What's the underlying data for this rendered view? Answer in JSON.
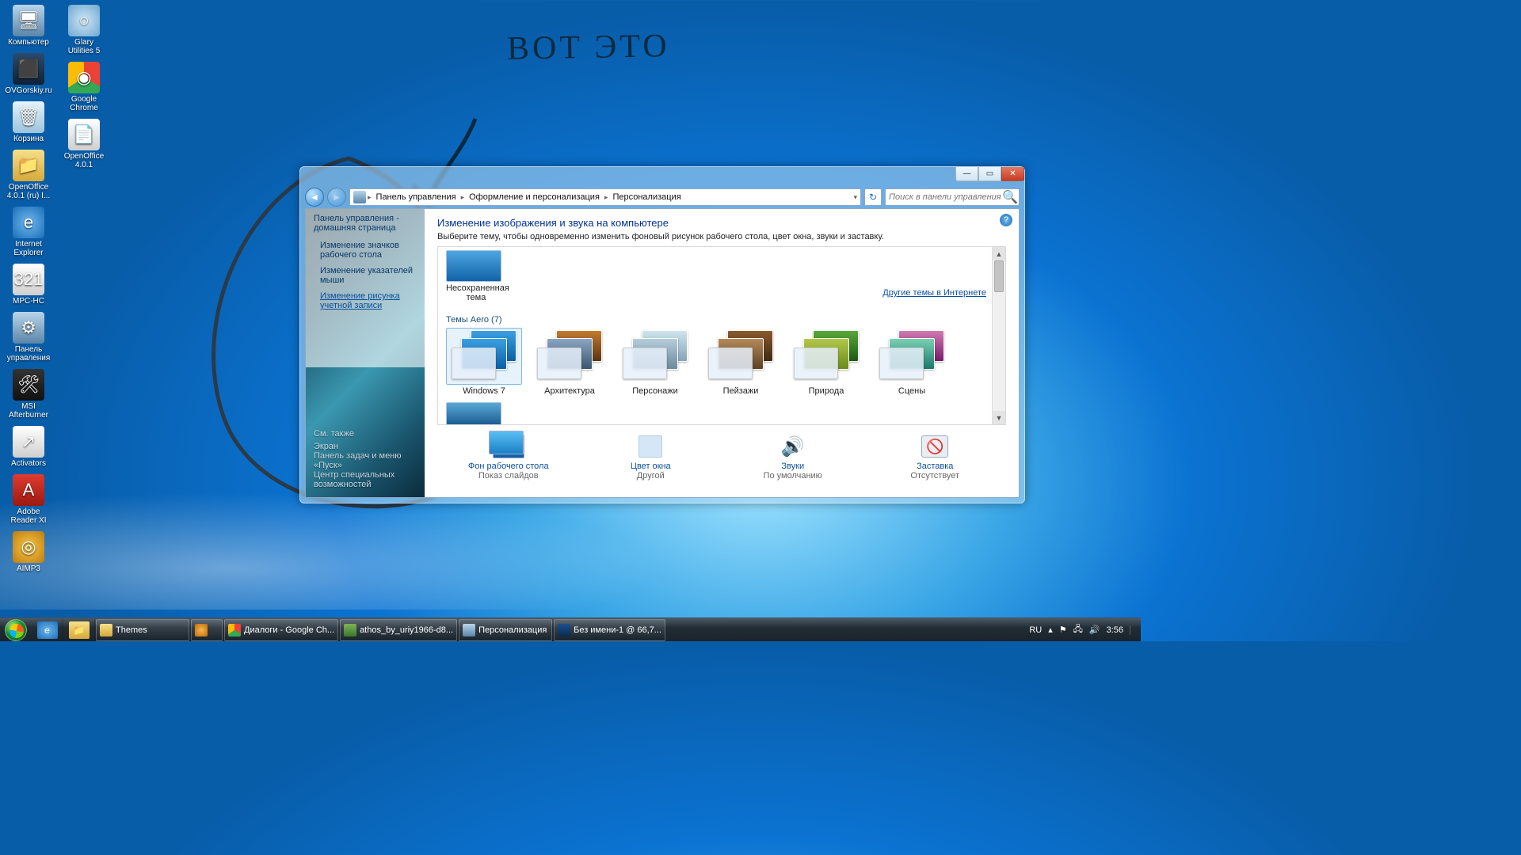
{
  "annotation": "ВОТ ЭТО",
  "desktop_icons": [
    {
      "label": "Компьютер",
      "bg": "linear-gradient(#b8d4ea,#5b86a8)",
      "glyph": "🖥"
    },
    {
      "label": "OVGorskiy.ru",
      "bg": "linear-gradient(#2b4b6e,#0e2236)",
      "glyph": "⬛"
    },
    {
      "label": "Корзина",
      "bg": "linear-gradient(#e6f3fb,#9cc3dc)",
      "glyph": "🗑"
    },
    {
      "label": "OpenOffice 4.0.1 (ru) I...",
      "bg": "linear-gradient(#f6e08a,#d6a83a)",
      "glyph": "📁"
    },
    {
      "label": "Internet Explorer",
      "bg": "radial-gradient(#6fb8ef,#1b6eb8)",
      "glyph": "e"
    },
    {
      "label": "MPC-HC",
      "bg": "linear-gradient(#fff,#cfcfcf)",
      "glyph": "321"
    },
    {
      "label": "Панель управления",
      "bg": "linear-gradient(#b8d4ea,#5b86a8)",
      "glyph": "⚙"
    },
    {
      "label": "MSI Afterburner",
      "bg": "linear-gradient(#333,#111)",
      "glyph": "🛠"
    },
    {
      "label": "Activators",
      "bg": "linear-gradient(#fff,#cfcfcf)",
      "glyph": "↗"
    },
    {
      "label": "Adobe Reader XI",
      "bg": "linear-gradient(#e03b2f,#9c1910)",
      "glyph": "A"
    },
    {
      "label": "AIMP3",
      "bg": "radial-gradient(#f7c84a,#c07b0c)",
      "glyph": "◎"
    },
    {
      "label": "Glary Utilities 5",
      "bg": "radial-gradient(#cfe7f6,#6ea6cf)",
      "glyph": "○"
    },
    {
      "label": "Google Chrome",
      "bg": "conic-gradient(#ea4335 0 33%,#34a853 0 66%,#fbbc05 0)",
      "glyph": "◉"
    },
    {
      "label": "OpenOffice 4.0.1",
      "bg": "linear-gradient(#fff,#cfcfcf)",
      "glyph": "📄"
    }
  ],
  "window": {
    "breadcrumb": [
      "Панель управления",
      "Оформление и персонализация",
      "Персонализация"
    ],
    "search_placeholder": "Поиск в панели управления",
    "sidebar": {
      "home": "Панель управления - домашняя страница",
      "links": [
        "Изменение значков рабочего стола",
        "Изменение указателей мыши",
        "Изменение рисунка учетной записи"
      ],
      "see_also_heading": "См. также",
      "see_also": [
        "Экран",
        "Панель задач и меню «Пуск»",
        "Центр специальных возможностей"
      ]
    },
    "main": {
      "heading": "Изменение изображения и звука на компьютере",
      "subheading": "Выберите тему, чтобы одновременно изменить фоновый рисунок рабочего стола, цвет окна, звуки и заставку.",
      "unsaved_theme_label": "Несохраненная тема",
      "more_link": "Другие темы в Интернете",
      "aero_heading": "Темы Aero (7)",
      "themes": [
        {
          "label": "Windows 7",
          "c1": "linear-gradient(#3aa0e2,#0b5fa6)",
          "c2": "linear-gradient(#3aa0e2,#0b5fa6)",
          "selected": true
        },
        {
          "label": "Архитектура",
          "c1": "linear-gradient(#c47b2e,#5a3414)",
          "c2": "linear-gradient(#8aa6c2,#3a5670)"
        },
        {
          "label": "Персонажи",
          "c1": "linear-gradient(#cfe4ee,#86a5b7)",
          "c2": "linear-gradient(#b6cddb,#6a8a9c)"
        },
        {
          "label": "Пейзажи",
          "c1": "linear-gradient(#8a5a2e,#402a14)",
          "c2": "linear-gradient(#b58a5a,#5e3f23)"
        },
        {
          "label": "Природа",
          "c1": "linear-gradient(#5aa83a,#1a5a14)",
          "c2": "linear-gradient(#b3c84a,#6a8a1a)"
        },
        {
          "label": "Сцены",
          "c1": "linear-gradient(#d07ab3,#7a1a6a)",
          "c2": "linear-gradient(#7ad0b3,#1a7a6a)"
        }
      ],
      "bottom": [
        {
          "label": "Фон рабочего стола",
          "sub": "Показ слайдов",
          "icon": "wallpaper"
        },
        {
          "label": "Цвет окна",
          "sub": "Другой",
          "icon": "color"
        },
        {
          "label": "Звуки",
          "sub": "По умолчанию",
          "icon": "sound"
        },
        {
          "label": "Заставка",
          "sub": "Отсутствует",
          "icon": "screensaver"
        }
      ]
    }
  },
  "taskbar": {
    "pinned": [
      {
        "name": "internet-explorer",
        "bg": "radial-gradient(#6fb8ef,#1b6eb8)",
        "glyph": "e"
      },
      {
        "name": "explorer",
        "bg": "linear-gradient(#f6e08a,#d6a83a)",
        "glyph": "📁"
      }
    ],
    "tasks": [
      {
        "label": "Themes",
        "bg": "linear-gradient(#f6e08a,#d6a83a)"
      },
      {
        "label": "",
        "bg": "radial-gradient(#f7b84a,#c06b0c)"
      },
      {
        "label": "Диалоги - Google Ch...",
        "bg": "conic-gradient(#ea4335 0 33%,#34a853 0 66%,#fbbc05 0)"
      },
      {
        "label": "athos_by_uriy1966-d8...",
        "bg": "linear-gradient(#7fb257,#3a7a2a)"
      },
      {
        "label": "Персонализация",
        "bg": "linear-gradient(#b8d4ea,#5b86a8)"
      },
      {
        "label": "Без имени-1 @ 66,7...",
        "bg": "linear-gradient(#1c4f8b,#0a2b50)"
      }
    ],
    "lang": "RU",
    "time": "3:56"
  }
}
